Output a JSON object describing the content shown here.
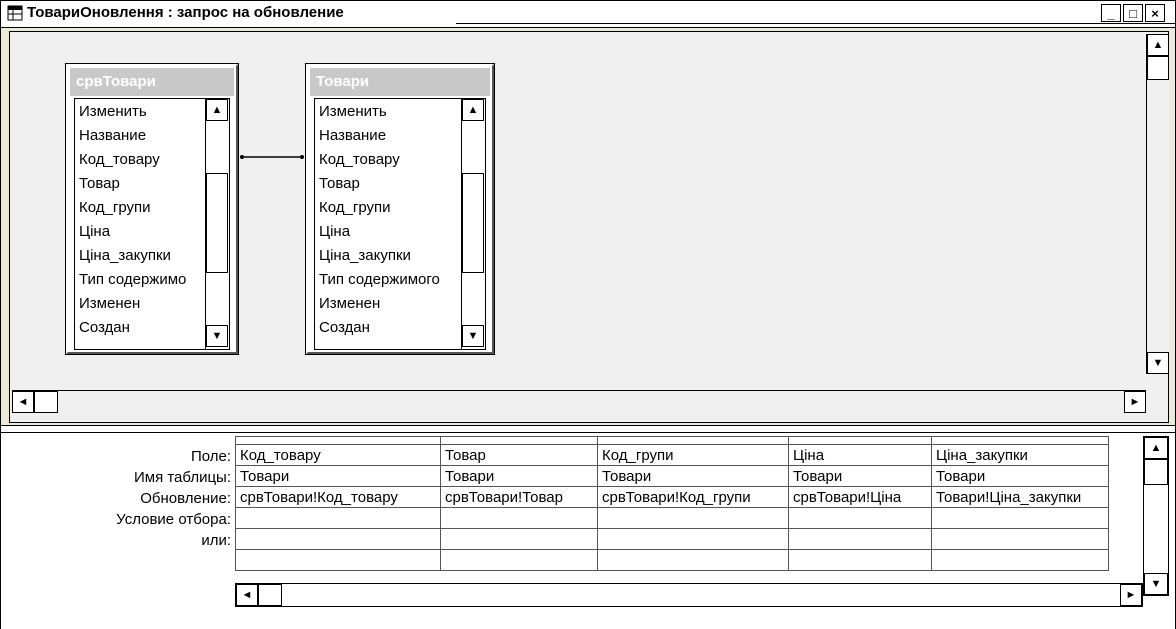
{
  "window": {
    "title": "ТовариОновлення : запрос на обновление",
    "minimize": "_",
    "maximize": "□",
    "close": "×"
  },
  "tables": [
    {
      "name": "срвТовари",
      "fields": [
        "Изменить",
        "Название",
        "Код_товару",
        "Товар",
        "Код_групи",
        "Ціна",
        "Ціна_закупки",
        "Тип содержимо",
        "Изменен",
        "Создан"
      ]
    },
    {
      "name": "Товари",
      "fields": [
        "Изменить",
        "Название",
        "Код_товару",
        "Товар",
        "Код_групи",
        "Ціна",
        "Ціна_закупки",
        "Тип содержимого",
        "Изменен",
        "Создан"
      ]
    }
  ],
  "grid": {
    "row_labels": [
      "Поле:",
      "Имя таблицы:",
      "Обновление:",
      "Условие отбора:",
      "или:"
    ],
    "columns": [
      {
        "field": "Код_товару",
        "table": "Товари",
        "update": "срвТовари!Код_товару",
        "criteria": "",
        "or": ""
      },
      {
        "field": "Товар",
        "table": "Товари",
        "update": "срвТовари!Товар",
        "criteria": "",
        "or": ""
      },
      {
        "field": "Код_групи",
        "table": "Товари",
        "update": "срвТовари!Код_групи",
        "criteria": "",
        "or": ""
      },
      {
        "field": "Ціна",
        "table": "Товари",
        "update": "срвТовари!Ціна",
        "criteria": "",
        "or": ""
      },
      {
        "field": "Ціна_закупки",
        "table": "Товари",
        "update": "Товари!Ціна_закупки",
        "criteria": "",
        "or": ""
      }
    ]
  },
  "icons": {
    "app": "query-window-icon",
    "up": "▲",
    "down": "▼",
    "left": "◄",
    "right": "►"
  }
}
